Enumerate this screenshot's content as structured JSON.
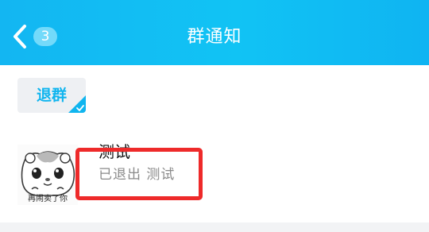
{
  "header": {
    "title": "群通知",
    "back_icon": "chevron-left-icon",
    "unread_count": "3",
    "background": "#13b6f2"
  },
  "filter": {
    "label": "退群",
    "selected": true,
    "accent": "#10b5ef",
    "check_icon": "checkmark-icon"
  },
  "notice": {
    "group_name": "测试",
    "message": "已退出 测试",
    "avatar": {
      "icon": "hamster-sticker-avatar",
      "caption": "再闹卖了你"
    }
  },
  "annotation": {
    "color": "#ee2a2a"
  }
}
